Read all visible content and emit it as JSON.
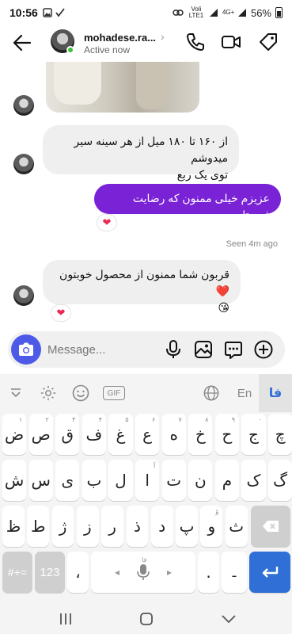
{
  "status_bar": {
    "time": "10:56",
    "net1": "Voli LTE1",
    "net2": "4G+",
    "battery": "56%"
  },
  "header": {
    "name": "mohadese.ra...",
    "status": "Active now",
    "chevron": "›"
  },
  "messages": [
    {
      "from": "other",
      "kind": "image"
    },
    {
      "from": "other",
      "lines": [
        "از ۱۶۰ تا ۱۸۰ میل از هر سینه سیر میدوشم",
        "توی یک ربع"
      ]
    },
    {
      "from": "me",
      "text": "عزیزم خیلی ممنون که رضایت فرستادید",
      "reaction": "❤"
    },
    {
      "seen": "Seen 4m ago"
    },
    {
      "from": "other",
      "text": "قربون شما ممنون از محصول خوبتون ❤️",
      "emoji": "😘",
      "reaction": "❤"
    }
  ],
  "composer": {
    "placeholder": "Message..."
  },
  "keyboard": {
    "toolbar": {
      "lang_en": "En",
      "lang_fa": "فا",
      "gif": "GIF"
    },
    "row1": [
      {
        "k": "ض",
        "h": "۱"
      },
      {
        "k": "ص",
        "h": "۲"
      },
      {
        "k": "ق",
        "h": "۳"
      },
      {
        "k": "ف",
        "h": "۴"
      },
      {
        "k": "غ",
        "h": "۵"
      },
      {
        "k": "ع",
        "h": "۶"
      },
      {
        "k": "ه",
        "h": "۷"
      },
      {
        "k": "خ",
        "h": "۸"
      },
      {
        "k": "ح",
        "h": "۹"
      },
      {
        "k": "ج",
        "h": "۰"
      },
      {
        "k": "چ",
        "h": ""
      }
    ],
    "row2": [
      {
        "k": "ش",
        "h": ""
      },
      {
        "k": "س",
        "h": ""
      },
      {
        "k": "ی",
        "h": ""
      },
      {
        "k": "ب",
        "h": ""
      },
      {
        "k": "ل",
        "h": ""
      },
      {
        "k": "ا",
        "h": "آ"
      },
      {
        "k": "ت",
        "h": ""
      },
      {
        "k": "ن",
        "h": ""
      },
      {
        "k": "م",
        "h": ""
      },
      {
        "k": "ک",
        "h": ""
      },
      {
        "k": "گ",
        "h": ""
      }
    ],
    "row3": [
      {
        "k": "ظ",
        "h": ""
      },
      {
        "k": "ط",
        "h": ""
      },
      {
        "k": "ژ",
        "h": ""
      },
      {
        "k": "ز",
        "h": ""
      },
      {
        "k": "ر",
        "h": ""
      },
      {
        "k": "ذ",
        "h": ""
      },
      {
        "k": "د",
        "h": ""
      },
      {
        "k": "پ",
        "h": ""
      },
      {
        "k": "و",
        "h": "ؤ"
      },
      {
        "k": "ث",
        "h": ""
      }
    ],
    "row4": {
      "symbols": "#+=",
      "numbers": "123",
      "comma": "،",
      "space_lang": "فا",
      "period": ".",
      "zwnj": "ـ‌"
    }
  },
  "colors": {
    "accent_purple": "#7a22d6",
    "camera_blue": "#4d5ae8",
    "keyboard_blue": "#2f6fd6",
    "online_green": "#3ac13a"
  },
  "icons": {
    "back": "back-arrow-icon",
    "call": "phone-icon",
    "video": "video-camera-icon",
    "tag": "tag-icon",
    "camera": "camera-icon",
    "mic": "microphone-icon",
    "gallery": "gallery-icon",
    "sticker": "chat-bubble-icon",
    "add": "plus-circle-icon"
  }
}
